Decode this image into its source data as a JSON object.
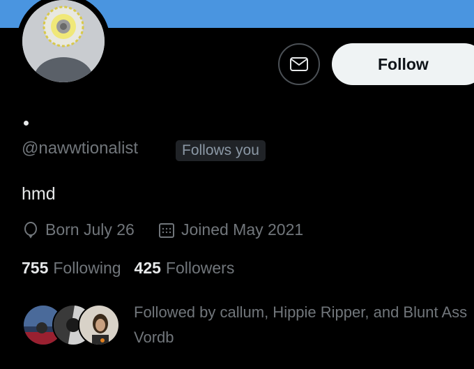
{
  "colors": {
    "background": "#000000",
    "banner": "#4a95e0",
    "primary_text": "#e7e9ea",
    "secondary_text": "#71767b",
    "follow_button_bg": "#eff3f4"
  },
  "profile": {
    "handle": "@nawwtionalist",
    "follows_you_badge": "Follows you",
    "bio": "hmd",
    "birthday": "Born July 26",
    "joined": "Joined May 2021",
    "following_count": "755",
    "following_label": "Following",
    "followers_count": "425",
    "followers_label": "Followers"
  },
  "actions": {
    "message_icon": "envelope-icon",
    "follow_label": "Follow"
  },
  "followed_by": {
    "text": "Followed by callum, Hippie Ripper, and Blunt Ass Vordb"
  },
  "icons": {
    "birthday": "balloon-icon",
    "joined": "calendar-icon"
  }
}
